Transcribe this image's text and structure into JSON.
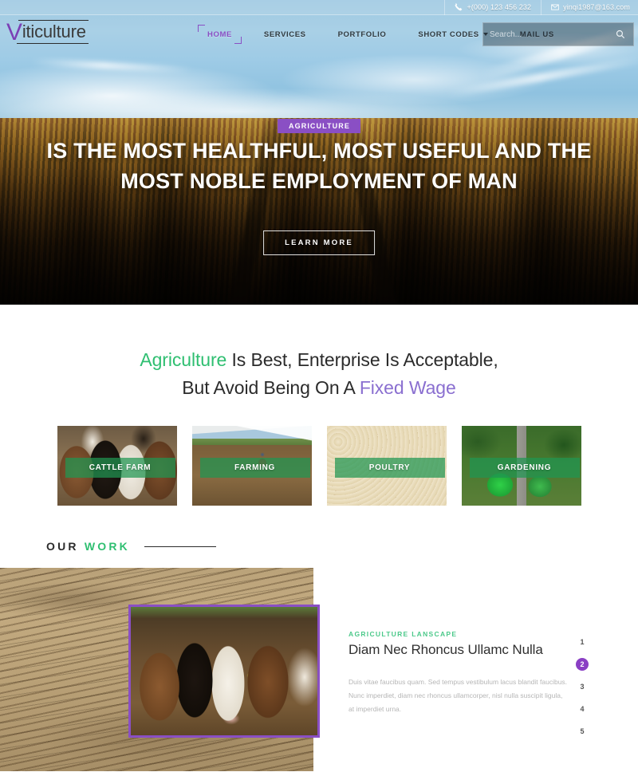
{
  "topbar": {
    "phone": "+(000) 123 456 232",
    "email": "yinqi1987@163.com",
    "phone_icon": "phone-icon",
    "email_icon": "envelope-icon"
  },
  "brand": {
    "initial": "V",
    "rest": "iticulture",
    "accent_color": "#7b3fb5"
  },
  "nav": {
    "items": [
      {
        "label": "HOME",
        "active": true,
        "dropdown": false
      },
      {
        "label": "SERVICES",
        "active": false,
        "dropdown": false
      },
      {
        "label": "PORTFOLIO",
        "active": false,
        "dropdown": false
      },
      {
        "label": "SHORT CODES",
        "active": false,
        "dropdown": true
      },
      {
        "label": "MAIL US",
        "active": false,
        "dropdown": false
      }
    ]
  },
  "search": {
    "placeholder": "Search...",
    "value": "",
    "icon": "search-icon"
  },
  "hero": {
    "badge": "AGRICULTURE",
    "title_line1": "IS THE MOST HEALTHFUL, MOST USEFUL AND THE",
    "title_line2": "MOST NOBLE EMPLOYMENT OF MAN",
    "button": "LEARN MORE",
    "badge_color": "#8a4fc4"
  },
  "intro": {
    "line1_accent": "Agriculture",
    "line1_rest": " Is Best, Enterprise Is Acceptable,",
    "line2_rest": "But Avoid Being On A ",
    "line2_accent": "Fixed Wage",
    "green": "#2fbf71",
    "purple": "#8a6fd0"
  },
  "cards": [
    {
      "label": "CATTLE FARM",
      "image": "cattle-photo"
    },
    {
      "label": "FARMING",
      "image": "farming-photo"
    },
    {
      "label": "POULTRY",
      "image": "poultry-photo"
    },
    {
      "label": "GARDENING",
      "image": "gardening-photo"
    }
  ],
  "ourwork": {
    "title_dark": "OUR ",
    "title_green": "WORK"
  },
  "work": {
    "eyebrow": "AGRICULTURE LANSCAPE",
    "heading": "Diam Nec Rhoncus Ullamc Nulla",
    "body": "Duis vitae faucibus quam. Sed tempus vestibulum lacus blandit faucibus. Nunc imperdiet, diam nec rhoncus ullamcorper, nisl nulla suscipit ligula, at imperdiet urna.",
    "pager": [
      "1",
      "2",
      "3",
      "4",
      "5"
    ],
    "pager_active_index": 1,
    "frame_color": "#8a4fc4"
  }
}
